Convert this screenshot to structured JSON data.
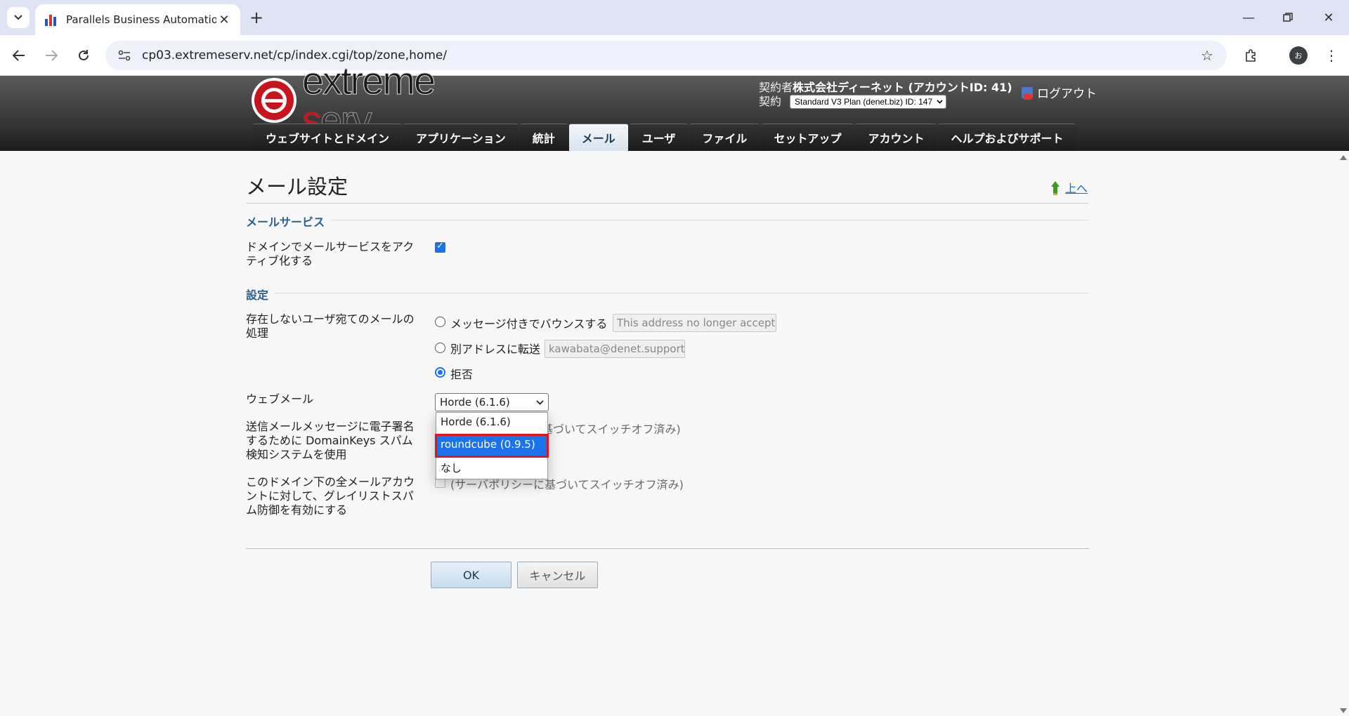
{
  "browser": {
    "tab_title": "Parallels Business Automation -",
    "url": "cp03.extremeserv.net/cp/index.cgi/top/zone,home/",
    "profile_initial": "お"
  },
  "header": {
    "logo_text_1": "extreme ",
    "logo_text_s": "s",
    "logo_text_2": "erv.",
    "contractor_label": "契約者",
    "contractor_name": "株式会社ディーネット (アカウントID: 41)",
    "contract_label": "契約",
    "contract_value": "Standard V3 Plan (denet.biz) ID: 147",
    "logout_label": "ログアウト",
    "tabs": [
      {
        "label": "ウェブサイトとドメイン"
      },
      {
        "label": "アプリケーション"
      },
      {
        "label": "統計"
      },
      {
        "label": "メール"
      },
      {
        "label": "ユーザ"
      },
      {
        "label": "ファイル"
      },
      {
        "label": "セットアップ"
      },
      {
        "label": "アカウント"
      },
      {
        "label": "ヘルプおよびサポート"
      }
    ],
    "active_tab": "メール"
  },
  "page": {
    "title": "メール設定",
    "up_link": "上へ",
    "section_mail_service": "メールサービス",
    "activate_label": "ドメインでメールサービスをアクティブ化する",
    "activate_checked": true,
    "section_settings": "設定",
    "nonexist_label": "存在しないユーザ宛てのメールの処理",
    "bounce_label": "メッセージ付きでバウンスする",
    "bounce_input_value": "This address no longer accepts",
    "forward_label": "別アドレスに転送",
    "forward_input_value": "kawabata@denet.support",
    "reject_label": "拒否",
    "selected_handling": "reject",
    "webmail_label": "ウェブメール",
    "webmail_selected": "Horde (6.1.6)",
    "webmail_options": [
      "Horde (6.1.6)",
      "roundcube (0.9.5)",
      "なし"
    ],
    "webmail_highlighted": "roundcube (0.9.5)",
    "domainkeys_label": "送信メールメッセージに電子署名するために DomainKeys スパム検知システムを使用",
    "domainkeys_note_visible": "基づいてスイッチオフ済み)",
    "greylist_label": "このドメイン下の全メールアカウントに対して、グレイリストスパム防御を有効にする",
    "greylist_note": "(サーバポリシーに基づいてスイッチオフ済み)",
    "ok_label": "OK",
    "cancel_label": "キャンセル"
  },
  "colors": {
    "accent": "#1a73e8",
    "brand_red": "#c8141e",
    "section_head": "#2a5f8f",
    "highlight_outline": "#e0141e"
  }
}
